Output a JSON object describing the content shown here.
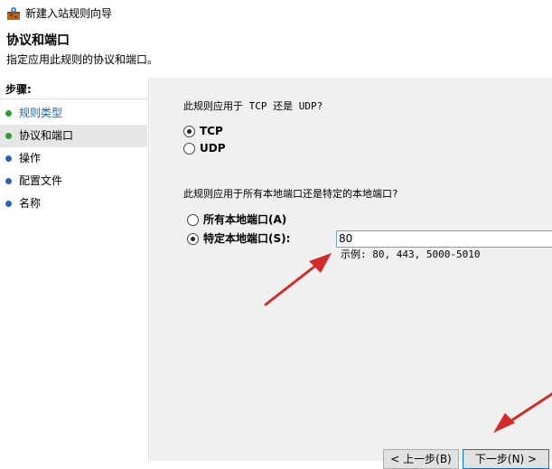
{
  "window": {
    "title": "新建入站规则向导",
    "app_icon": "firewall-wizard-icon"
  },
  "header": {
    "title": "协议和端口",
    "subtitle": "指定应用此规则的协议和端口。"
  },
  "sidebar": {
    "title": "步骤:",
    "steps": [
      {
        "label": "规则类型",
        "state": "done",
        "dot_color": "#2e9d2e"
      },
      {
        "label": "协议和端口",
        "state": "current",
        "dot_color": "#2e9d2e"
      },
      {
        "label": "操作",
        "state": "pending",
        "dot_color": "#2b63b8"
      },
      {
        "label": "配置文件",
        "state": "pending",
        "dot_color": "#2b63b8"
      },
      {
        "label": "名称",
        "state": "pending",
        "dot_color": "#2b63b8"
      }
    ]
  },
  "main": {
    "protocol_question": "此规则应用于 TCP 还是 UDP?",
    "protocol_options": [
      {
        "label": "TCP",
        "selected": true
      },
      {
        "label": "UDP",
        "selected": false
      }
    ],
    "port_question": "此规则应用于所有本地端口还是特定的本地端口?",
    "port_options": [
      {
        "label": "所有本地端口(A)",
        "selected": false
      },
      {
        "label": "特定本地端口(S):",
        "selected": true
      }
    ],
    "port_value": "80",
    "port_example": "示例: 80, 443, 5000-5010"
  },
  "buttons": {
    "back": "< 上一步(B)",
    "next": "下一步(N) >"
  },
  "annotation_color": "#d62a2a"
}
